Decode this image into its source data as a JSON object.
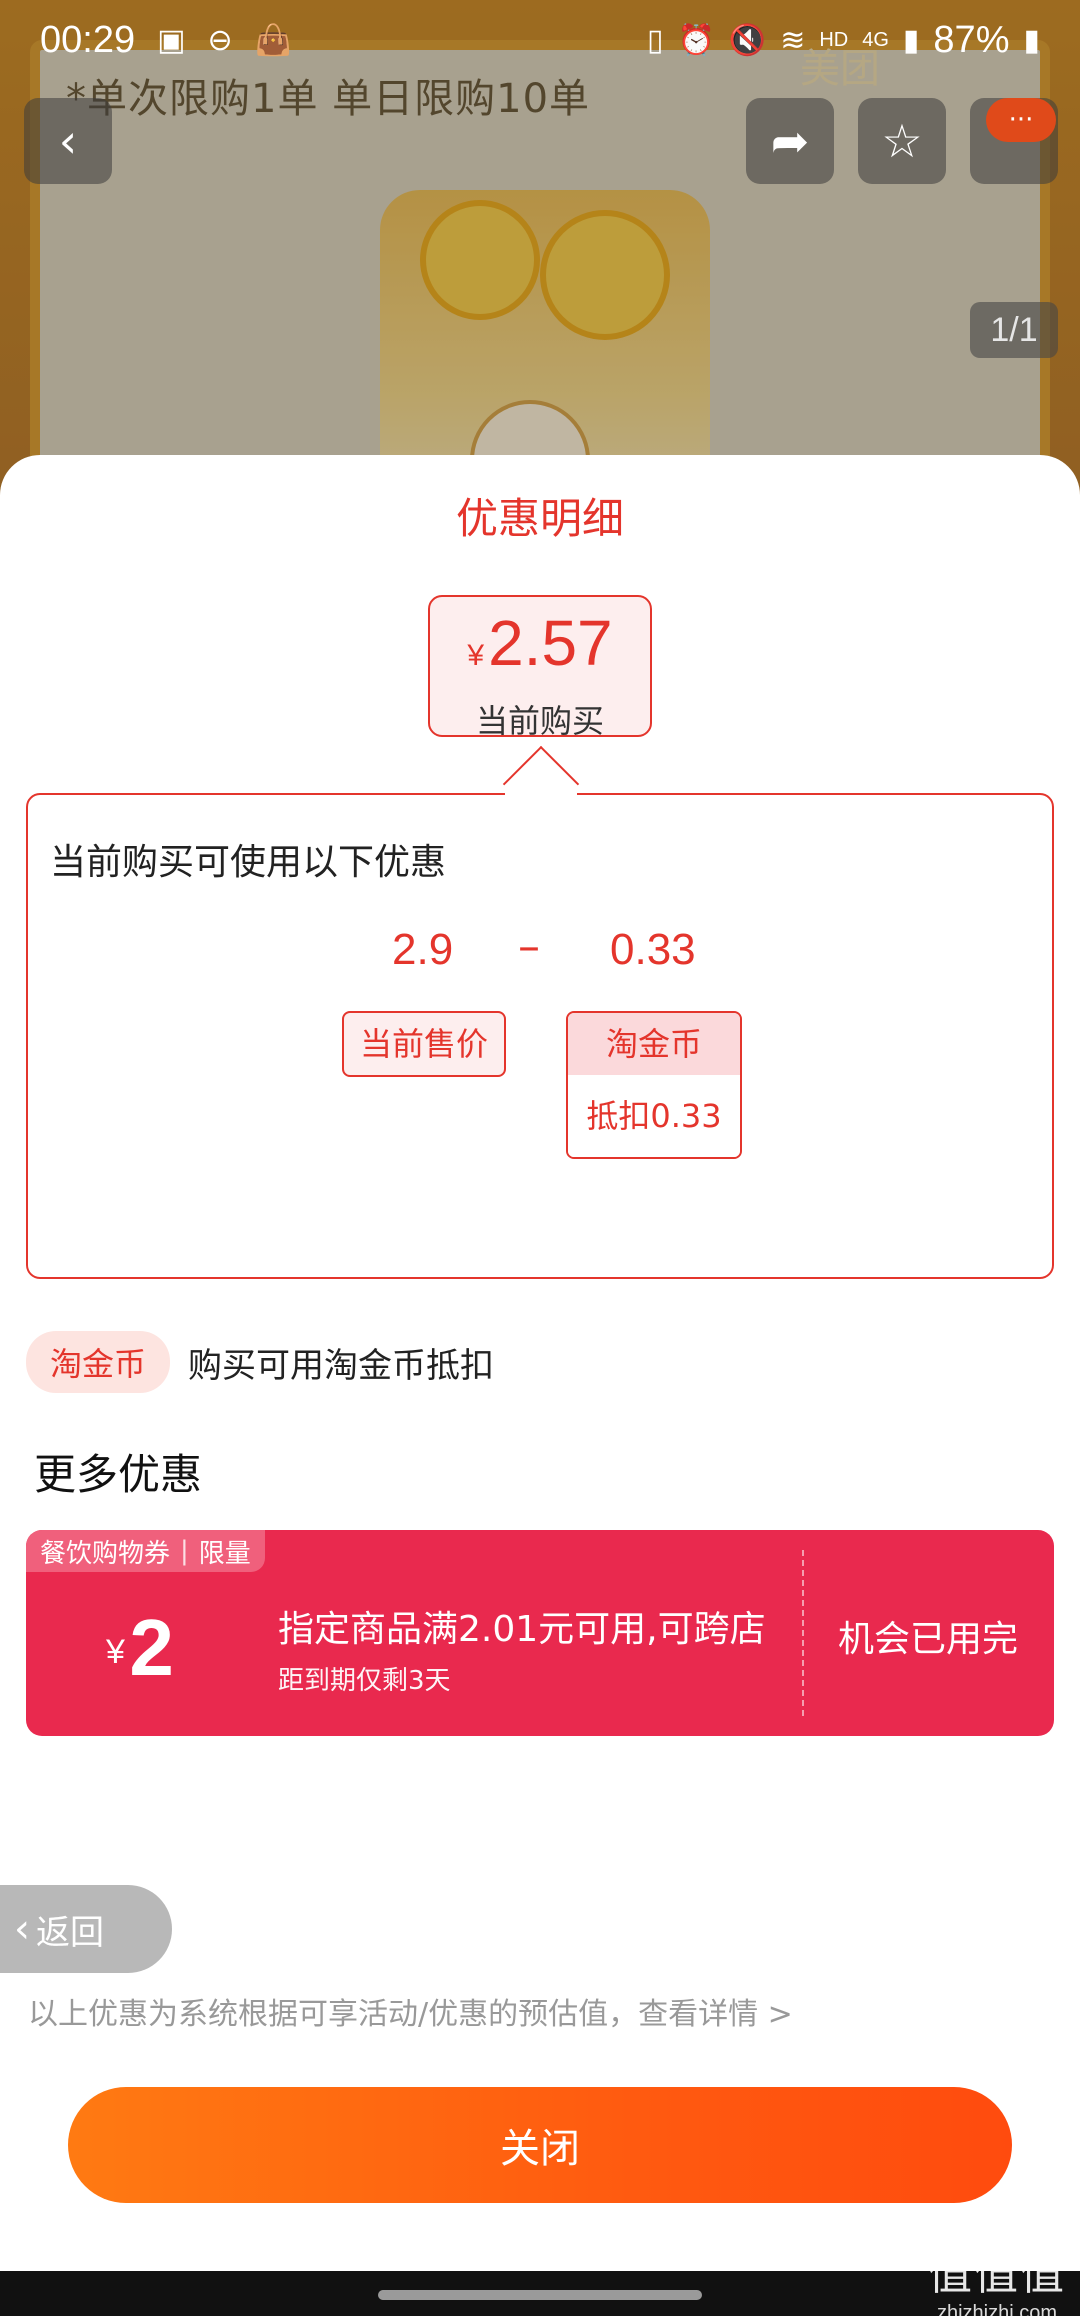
{
  "status_bar": {
    "time": "00:29",
    "battery": "87%",
    "network": "4G",
    "hd": "HD"
  },
  "background": {
    "limit_text": "*单次限购1单 单日限购10单",
    "brand_text": "美团",
    "page_indicator": "1/1",
    "more_badge": "···"
  },
  "sheet": {
    "title": "优惠明细",
    "current_price": {
      "currency": "¥",
      "value": "2.57",
      "label": "当前购买"
    },
    "detail": {
      "heading": "当前购买可使用以下优惠",
      "sale_price": "2.9",
      "minus": "–",
      "deduction": "0.33",
      "sale_label": "当前售价",
      "coin_label": "淘金币",
      "coin_detail": "抵扣0.33"
    },
    "coin_row": {
      "pill": "淘金币",
      "description": "购买可用淘金币抵扣"
    },
    "more_title": "更多优惠",
    "coupon": {
      "tag_type": "餐饮购物券",
      "tag_sep": "|",
      "tag_limit": "限量",
      "currency": "¥",
      "amount": "2",
      "condition": "指定商品满2.01元可用,可跨店",
      "expiry": "距到期仅剩3天",
      "status": "机会已用完"
    },
    "back_label": "返回",
    "disclaimer": "以上优惠为系统根据可享活动/优惠的预估值，查看详情 >",
    "close_label": "关闭"
  },
  "watermark": {
    "big": "值值值",
    "small": "zhizhizhi.com"
  },
  "colors": {
    "accent_red": "#e4352c",
    "coupon_bg": "#e9294e",
    "close_start": "#ff7a12",
    "close_end": "#ff4b0e"
  }
}
